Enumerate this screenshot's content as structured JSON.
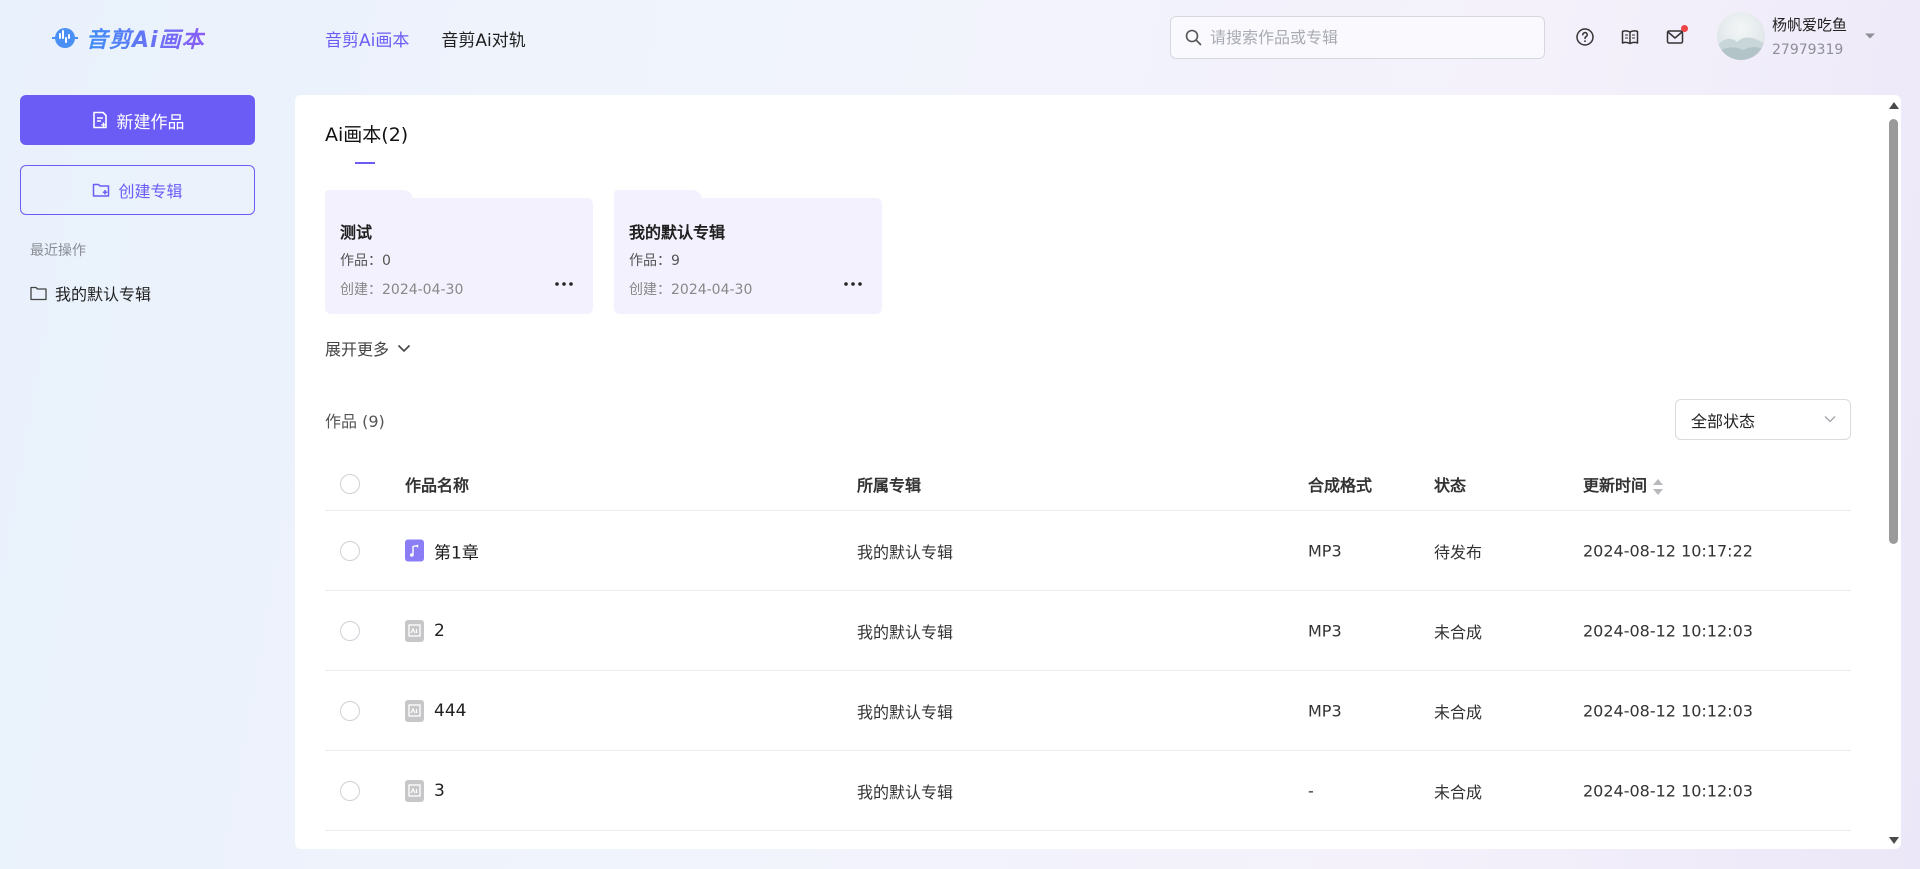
{
  "header": {
    "logo_text": "音剪Ai画本",
    "nav": [
      {
        "label": "音剪Ai画本",
        "active": true
      },
      {
        "label": "音剪Ai对轨",
        "active": false
      }
    ],
    "search_placeholder": "请搜索作品或专辑",
    "icons": [
      "help-icon",
      "book-icon",
      "mail-icon"
    ],
    "user": {
      "name": "杨帆爱吃鱼",
      "id": "27979319"
    }
  },
  "sidebar": {
    "new_work_label": "新建作品",
    "create_album_label": "创建专辑",
    "recent_label": "最近操作",
    "recent_items": [
      "我的默认专辑"
    ]
  },
  "albums": {
    "title": "Ai画本(2)",
    "cards": [
      {
        "title": "测试",
        "count": "作品：0",
        "date": "创建：2024-04-30"
      },
      {
        "title": "我的默认专辑",
        "count": "作品：9",
        "date": "创建：2024-04-30"
      }
    ],
    "expand_label": "展开更多"
  },
  "works": {
    "title": "作品 (9)",
    "status_filter": "全部状态",
    "columns": {
      "name": "作品名称",
      "album": "所属专辑",
      "format": "合成格式",
      "status": "状态",
      "updated": "更新时间"
    },
    "rows": [
      {
        "name": "第1章",
        "icon": "music-file-icon",
        "album": "我的默认专辑",
        "format": "MP3",
        "status": "待发布",
        "updated": "2024-08-12 10:17:22"
      },
      {
        "name": "2",
        "icon": "ai-doc-icon",
        "album": "我的默认专辑",
        "format": "MP3",
        "status": "未合成",
        "updated": "2024-08-12 10:12:03"
      },
      {
        "name": "444",
        "icon": "ai-doc-icon",
        "album": "我的默认专辑",
        "format": "MP3",
        "status": "未合成",
        "updated": "2024-08-12 10:12:03"
      },
      {
        "name": "3",
        "icon": "ai-doc-icon",
        "album": "我的默认专辑",
        "format": "-",
        "status": "未合成",
        "updated": "2024-08-12 10:12:03"
      }
    ]
  },
  "colors": {
    "accent": "#6b5cf5",
    "card_bg": "#f3f1fd",
    "notification": "#f04545"
  }
}
